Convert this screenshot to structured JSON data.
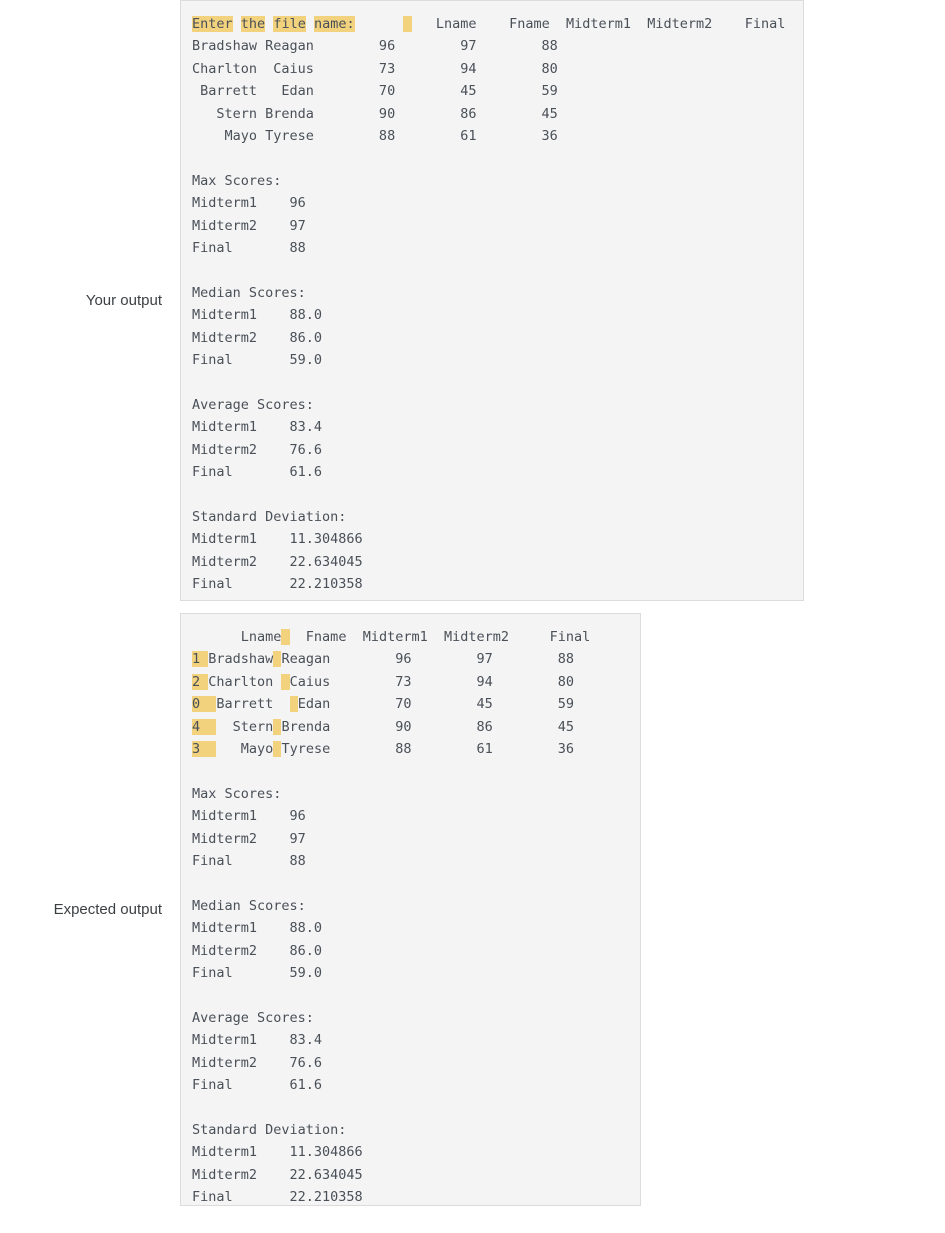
{
  "colors": {
    "panel_background": "#f4f4f4",
    "panel_border": "#dcdcdc",
    "console_text": "#4a5058",
    "diff_highlight": "#f2d27c",
    "label_text": "#3c4043"
  },
  "your_output": {
    "label": "Your output",
    "prompt_segments": [
      {
        "text": "Enter",
        "highlighted": true
      },
      {
        "text": " ",
        "highlighted": false
      },
      {
        "text": "the",
        "highlighted": true
      },
      {
        "text": " ",
        "highlighted": false
      },
      {
        "text": "file",
        "highlighted": true
      },
      {
        "text": " ",
        "highlighted": false
      },
      {
        "text": "name:",
        "highlighted": true
      },
      {
        "text": "      ",
        "highlighted": false
      },
      {
        "text": " ",
        "highlighted": true
      }
    ],
    "header_tail": "   Lname    Fname  Midterm1  Midterm2    Final",
    "table": {
      "columns": [
        "Lname",
        "Fname",
        "Midterm1",
        "Midterm2",
        "Final"
      ],
      "rows": [
        {
          "lname": "Bradshaw",
          "fname": "Reagan",
          "midterm1": "96",
          "midterm2": "97",
          "final": "88"
        },
        {
          "lname": "Charlton",
          "fname": "Caius",
          "midterm1": "73",
          "midterm2": "94",
          "final": "80"
        },
        {
          "lname": "Barrett",
          "fname": "Edan",
          "midterm1": "70",
          "midterm2": "45",
          "final": "59"
        },
        {
          "lname": "Stern",
          "fname": "Brenda",
          "midterm1": "90",
          "midterm2": "86",
          "final": "45"
        },
        {
          "lname": "Mayo",
          "fname": "Tyrese",
          "midterm1": "88",
          "midterm2": "61",
          "final": "36"
        }
      ]
    },
    "rows_text": [
      "Bradshaw Reagan        96        97        88",
      "Charlton  Caius        73        94        80",
      " Barrett   Edan        70        45        59",
      "   Stern Brenda        90        86        45",
      "    Mayo Tyrese        88        61        36"
    ],
    "stats": [
      {
        "title": "Max Scores:",
        "entries": [
          {
            "label": "Midterm1",
            "value": "96"
          },
          {
            "label": "Midterm2",
            "value": "97"
          },
          {
            "label": "Final",
            "value": "88"
          }
        ]
      },
      {
        "title": "Median Scores:",
        "entries": [
          {
            "label": "Midterm1",
            "value": "88.0"
          },
          {
            "label": "Midterm2",
            "value": "86.0"
          },
          {
            "label": "Final",
            "value": "59.0"
          }
        ]
      },
      {
        "title": "Average Scores:",
        "entries": [
          {
            "label": "Midterm1",
            "value": "83.4"
          },
          {
            "label": "Midterm2",
            "value": "76.6"
          },
          {
            "label": "Final",
            "value": "61.6"
          }
        ]
      },
      {
        "title": "Standard Deviation:",
        "entries": [
          {
            "label": "Midterm1",
            "value": "11.304866"
          },
          {
            "label": "Midterm2",
            "value": "22.634045"
          },
          {
            "label": "Final",
            "value": "22.210358"
          }
        ]
      }
    ],
    "stats_lines": [
      "Max Scores:",
      "Midterm1    96",
      "Midterm2    97",
      "Final       88",
      "",
      "Median Scores:",
      "Midterm1    88.0",
      "Midterm2    86.0",
      "Final       59.0",
      "",
      "Average Scores:",
      "Midterm1    83.4",
      "Midterm2    76.6",
      "Final       61.6",
      "",
      "Standard Deviation:",
      "Midterm1    11.304866",
      "Midterm2    22.634045",
      "Final       22.210358"
    ]
  },
  "expected_output": {
    "label": "Expected output",
    "header": {
      "pre": "      Lname",
      "gap_highlighted": " ",
      "post": "  Fname  Midterm1  Midterm2     Final"
    },
    "table": {
      "columns": [
        "Lname",
        "Fname",
        "Midterm1",
        "Midterm2",
        "Final"
      ],
      "rows": [
        {
          "index": "1",
          "lname": "Bradshaw",
          "fname": "Reagan",
          "midterm1": "96",
          "midterm2": "97",
          "final": "88"
        },
        {
          "index": "2",
          "lname": "Charlton",
          "fname": "Caius",
          "midterm1": "73",
          "midterm2": "94",
          "final": "80"
        },
        {
          "index": "0",
          "lname": "Barrett",
          "fname": "Edan",
          "midterm1": "70",
          "midterm2": "45",
          "final": "59"
        },
        {
          "index": "4",
          "lname": "Stern",
          "fname": "Brenda",
          "midterm1": "90",
          "midterm2": "86",
          "final": "45"
        },
        {
          "index": "3",
          "lname": "Mayo",
          "fname": "Tyrese",
          "midterm1": "88",
          "midterm2": "61",
          "final": "36"
        }
      ]
    },
    "stats": [
      {
        "title": "Max Scores:",
        "entries": [
          {
            "label": "Midterm1",
            "value": "96"
          },
          {
            "label": "Midterm2",
            "value": "97"
          },
          {
            "label": "Final",
            "value": "88"
          }
        ]
      },
      {
        "title": "Median Scores:",
        "entries": [
          {
            "label": "Midterm1",
            "value": "88.0"
          },
          {
            "label": "Midterm2",
            "value": "86.0"
          },
          {
            "label": "Final",
            "value": "59.0"
          }
        ]
      },
      {
        "title": "Average Scores:",
        "entries": [
          {
            "label": "Midterm1",
            "value": "83.4"
          },
          {
            "label": "Midterm2",
            "value": "76.6"
          },
          {
            "label": "Final",
            "value": "61.6"
          }
        ]
      },
      {
        "title": "Standard Deviation:",
        "entries": [
          {
            "label": "Midterm1",
            "value": "11.304866"
          },
          {
            "label": "Midterm2",
            "value": "22.634045"
          },
          {
            "label": "Final",
            "value": "22.210358"
          }
        ]
      }
    ],
    "stats_lines": [
      "Max Scores:",
      "Midterm1    96",
      "Midterm2    97",
      "Final       88",
      "",
      "Median Scores:",
      "Midterm1    88.0",
      "Midterm2    86.0",
      "Final       59.0",
      "",
      "Average Scores:",
      "Midterm1    83.4",
      "Midterm2    76.6",
      "Final       61.6",
      "",
      "Standard Deviation:",
      "Midterm1    11.304866",
      "Midterm2    22.634045",
      "Final       22.210358"
    ]
  }
}
